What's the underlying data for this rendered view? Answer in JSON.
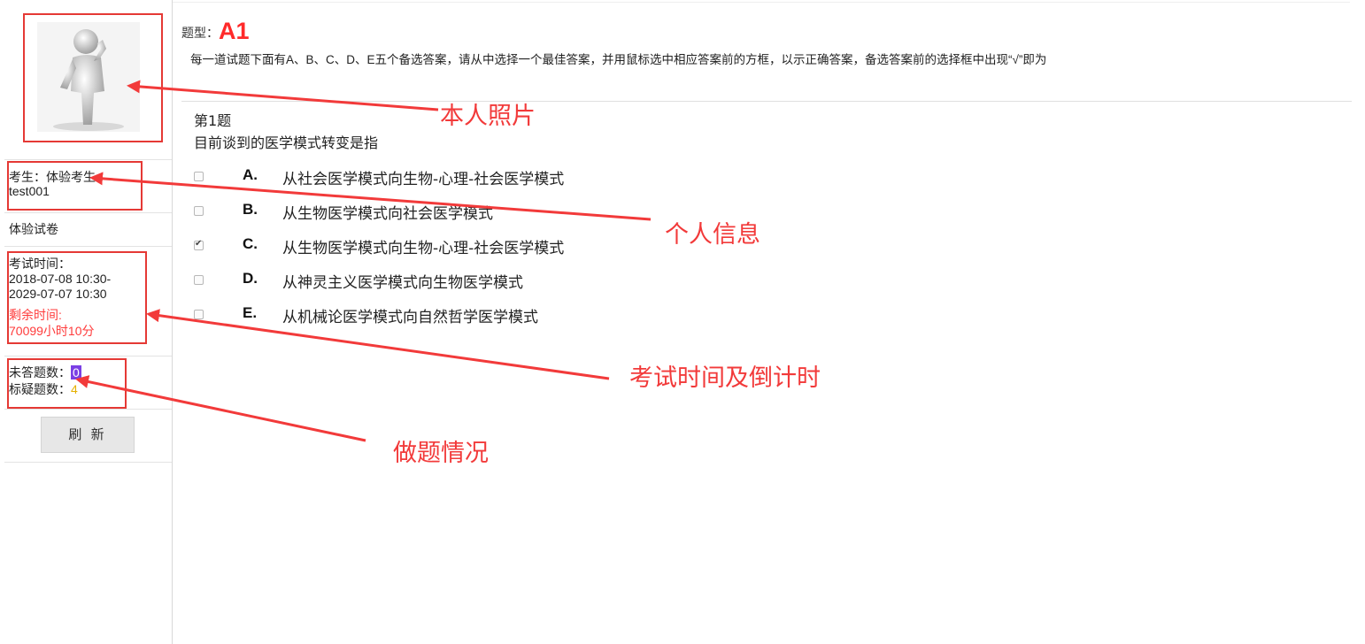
{
  "sidebar": {
    "candidate": "考生：体验考生",
    "candidate_id": "test001",
    "paper_name": "体验试卷",
    "exam_time_label": "考试时间：",
    "exam_time_start": "2018-07-08 10:30-",
    "exam_time_end": "2029-07-07 10:30",
    "remaining_label": "剩余时间:",
    "remaining_value": "70099小时10分",
    "unanswered_label": "未答题数：",
    "unanswered_value": "0",
    "flagged_label": "标疑题数：",
    "flagged_value": "4",
    "refresh_label": "刷 新"
  },
  "main": {
    "type_label": "题型：",
    "type_value": "A1",
    "instruction": "每一道试题下面有A、B、C、D、E五个备选答案，请从中选择一个最佳答案，并用鼠标选中相应答案前的方框，以示正确答案，备选答案前的选择框中出现“√”即为",
    "question_no": "第1题",
    "question_text": "目前谈到的医学模式转变是指",
    "options": [
      {
        "letter": "A.",
        "text": "从社会医学模式向生物-心理-社会医学模式",
        "checked": false
      },
      {
        "letter": "B.",
        "text": "从生物医学模式向社会医学模式",
        "checked": false
      },
      {
        "letter": "C.",
        "text": "从生物医学模式向生物-心理-社会医学模式",
        "checked": true
      },
      {
        "letter": "D.",
        "text": "从神灵主义医学模式向生物医学模式",
        "checked": false
      },
      {
        "letter": "E.",
        "text": "从机械论医学模式向自然哲学医学模式",
        "checked": false
      }
    ]
  },
  "annotations": {
    "photo": "本人照片",
    "personal_info": "个人信息",
    "exam_time": "考试时间及倒计时",
    "progress": "做题情况"
  },
  "colors": {
    "annotation_red": "#f23a3a",
    "remaining_red": "#ff3b3b",
    "type_red": "#ff2a2a",
    "unanswered_badge": "#7b3fe4"
  }
}
